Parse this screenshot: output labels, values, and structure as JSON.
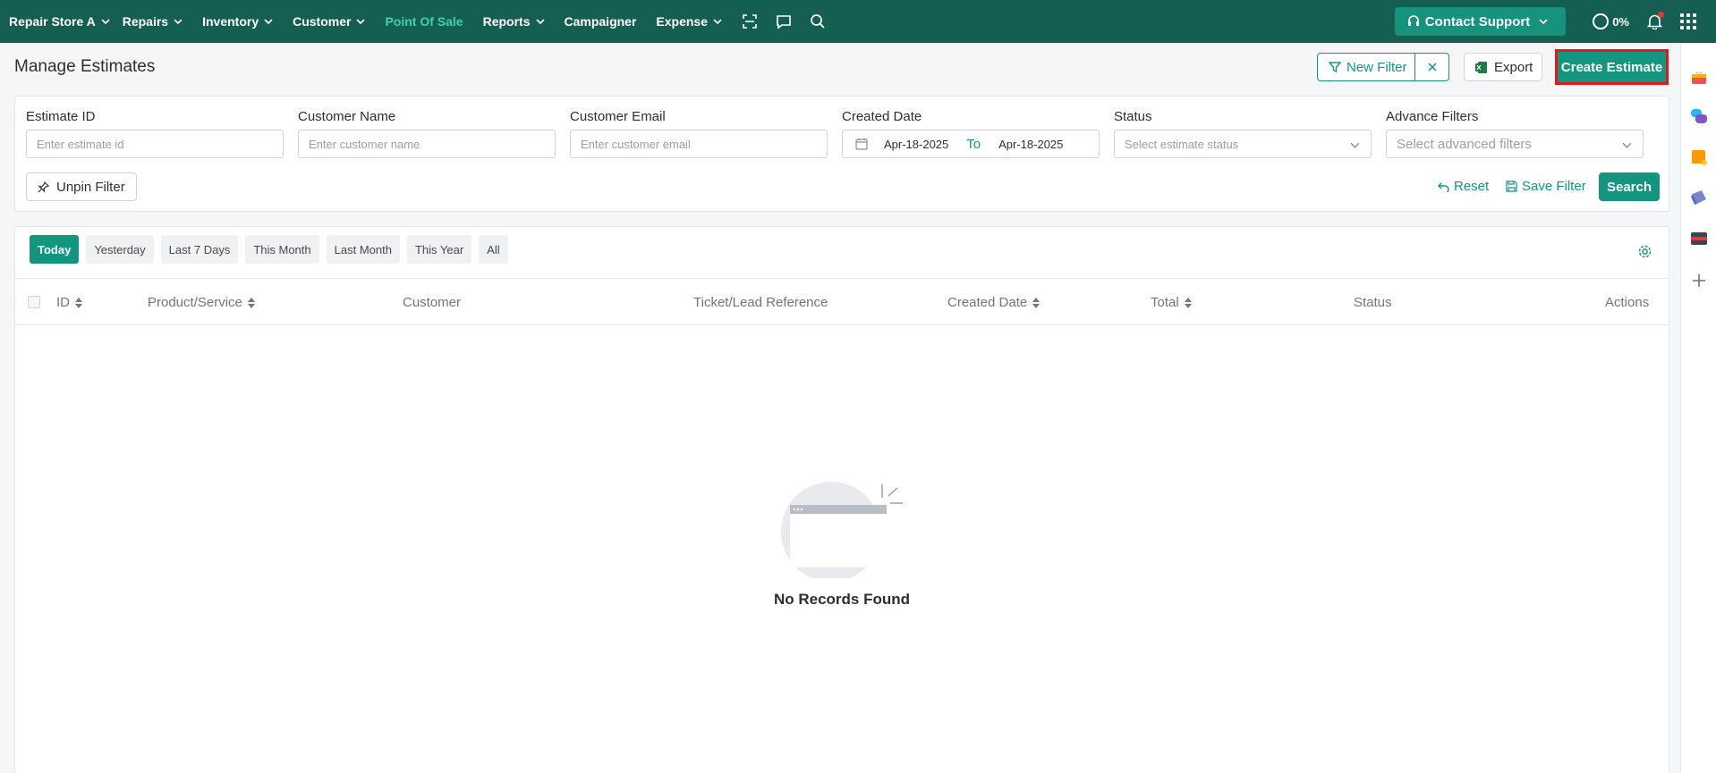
{
  "nav": {
    "store": "Repair Store A",
    "items": [
      {
        "label": "Repairs",
        "dropdown": true
      },
      {
        "label": "Inventory",
        "dropdown": true
      },
      {
        "label": "Customer",
        "dropdown": true
      },
      {
        "label": "Point Of Sale",
        "dropdown": false,
        "active": true
      },
      {
        "label": "Reports",
        "dropdown": true
      },
      {
        "label": "Campaigner",
        "dropdown": false
      },
      {
        "label": "Expense",
        "dropdown": true
      }
    ],
    "icons": [
      "scan-icon",
      "chat-icon",
      "search-icon"
    ],
    "support_label": "Contact Support",
    "progress": "0%"
  },
  "page": {
    "title": "Manage Estimates",
    "new_filter": "New Filter",
    "export": "Export",
    "create": "Create Estimate"
  },
  "filters": {
    "estimate_id": {
      "label": "Estimate ID",
      "placeholder": "Enter estimate id"
    },
    "customer_name": {
      "label": "Customer Name",
      "placeholder": "Enter customer name"
    },
    "customer_email": {
      "label": "Customer Email",
      "placeholder": "Enter customer email"
    },
    "created_date": {
      "label": "Created Date",
      "from": "Apr-18-2025",
      "to_label": "To",
      "to": "Apr-18-2025"
    },
    "status": {
      "label": "Status",
      "placeholder": "Select estimate status"
    },
    "advance": {
      "label": "Advance Filters",
      "placeholder": "Select advanced filters"
    },
    "unpin": "Unpin Filter",
    "reset": "Reset",
    "save": "Save Filter",
    "search": "Search"
  },
  "ranges": [
    "Today",
    "Yesterday",
    "Last 7 Days",
    "This Month",
    "Last Month",
    "This Year",
    "All"
  ],
  "table": {
    "columns": {
      "id": "ID",
      "product": "Product/Service",
      "customer": "Customer",
      "ticket": "Ticket/Lead Reference",
      "created": "Created Date",
      "total": "Total",
      "status": "Status",
      "actions": "Actions"
    },
    "empty": "No Records Found"
  },
  "colors": {
    "nav_bg": "#155e52",
    "accent": "#139580",
    "highlight": "#e01a1a"
  }
}
